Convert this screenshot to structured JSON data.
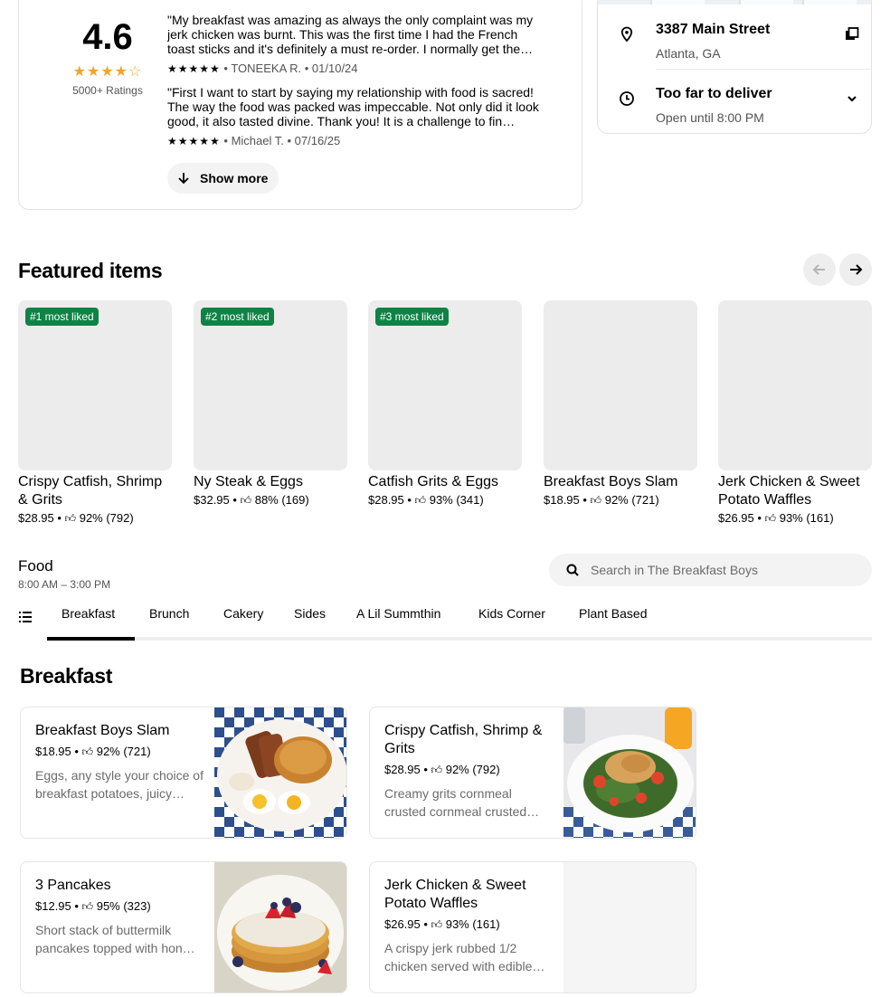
{
  "ratings": {
    "score": "4.6",
    "stars": "★★★★☆",
    "count": "5000+ Ratings",
    "reviews": [
      {
        "text": "\"My breakfast was amazing as always the only complaint was my jerk chicken was burnt. This was the first time I had the French toast sticks and it's definitely a must re-order. I normally get the…",
        "stars": "★★★★★",
        "meta": "• TONEEKA R. • 01/10/24"
      },
      {
        "text": "\"First I want to start by saying my relationship with food is sacred! The way the food was packed was impeccable. Not only did it look good, it also tasted divine. Thank you! It is a challenge to fin…",
        "stars": "★★★★★",
        "meta": "• Michael T. • 07/16/25"
      }
    ],
    "show_more": "Show more"
  },
  "store": {
    "address": "3387 Main Street",
    "city": "Atlanta, GA",
    "delivery_status": "Too far to deliver",
    "hours": "Open until 8:00 PM"
  },
  "featured": {
    "title": "Featured items",
    "items": [
      {
        "badge": "#1 most liked",
        "name": "Crispy Catfish, Shrimp & Grits",
        "price": "$28.95",
        "rating": "92% (792)"
      },
      {
        "badge": "#2 most liked",
        "name": "Ny Steak & Eggs",
        "price": "$32.95",
        "rating": "88% (169)"
      },
      {
        "badge": "#3 most liked",
        "name": "Catfish Grits & Eggs",
        "price": "$28.95",
        "rating": "93% (341)"
      },
      {
        "badge": "",
        "name": "Breakfast Boys Slam",
        "price": "$18.95",
        "rating": "92% (721)"
      },
      {
        "badge": "",
        "name": "Jerk Chicken & Sweet Potato Waffles",
        "price": "$26.95",
        "rating": "93% (161)"
      }
    ]
  },
  "menu": {
    "title": "Food",
    "hours": "8:00 AM – 3:00 PM",
    "search_placeholder": "Search in The Breakfast Boys",
    "tabs": [
      "Breakfast",
      "Brunch",
      "Cakery",
      "Sides",
      "A Lil Summthin",
      "Kids Corner",
      "Plant Based"
    ],
    "active_tab": "Breakfast"
  },
  "breakfast": {
    "title": "Breakfast",
    "items": [
      {
        "name": "Breakfast Boys Slam",
        "price": "$18.95",
        "rating": "92% (721)",
        "desc": "Eggs, any style your choice of breakfast potatoes, juicy…"
      },
      {
        "name": "Crispy Catfish, Shrimp & Grits",
        "price": "$28.95",
        "rating": "92% (792)",
        "desc": "Creamy grits cornmeal crusted cornmeal crusted…"
      },
      {
        "name": "3 Pancakes",
        "price": "$12.95",
        "rating": "95% (323)",
        "desc": "Short stack of buttermilk pancakes topped with hon…"
      },
      {
        "name": "Jerk Chicken & Sweet Potato Waffles",
        "price": "$26.95",
        "rating": "93% (161)",
        "desc": "A crispy jerk rubbed 1/2 chicken served with edible…"
      }
    ]
  },
  "icons": {
    "location": "location-pin-icon",
    "clock": "clock-icon",
    "copy": "copy-icon",
    "chevron": "chevron-down-icon",
    "search": "search-icon",
    "list": "list-icon",
    "thumb": "thumbs-up-icon"
  },
  "colors": {
    "badge": "#0e8345",
    "star": "#f0a52b"
  }
}
